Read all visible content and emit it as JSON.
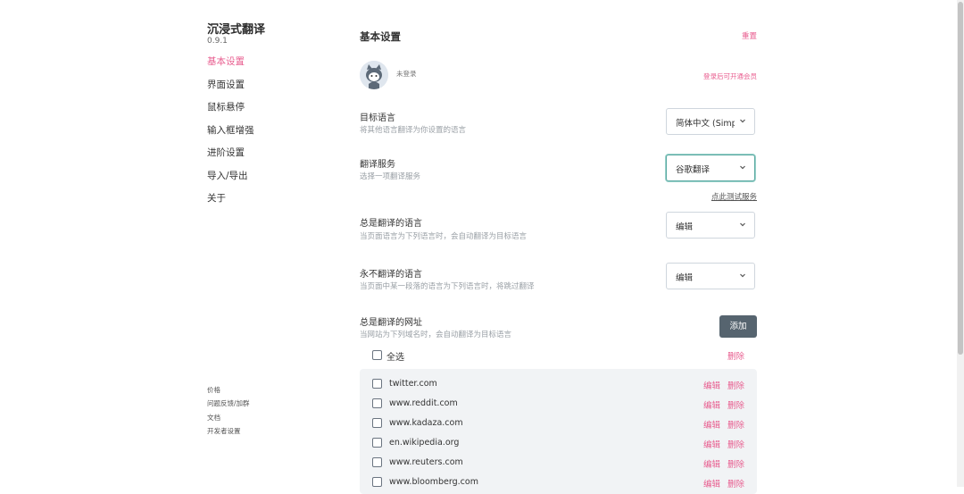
{
  "app": {
    "title": "沉浸式翻译",
    "version": "0.9.1"
  },
  "sidebar": {
    "items": [
      {
        "label": "基本设置",
        "active": true
      },
      {
        "label": "界面设置"
      },
      {
        "label": "鼠标悬停"
      },
      {
        "label": "输入框增强"
      },
      {
        "label": "进阶设置"
      },
      {
        "label": "导入/导出"
      },
      {
        "label": "关于"
      }
    ],
    "footer": [
      "价格",
      "问题反馈/加群",
      "文档",
      "开发者设置"
    ]
  },
  "header": {
    "title": "基本设置",
    "reset_label": "重置"
  },
  "account": {
    "status": "未登录",
    "member_link": "登录后可开通会员"
  },
  "settings": {
    "target_language": {
      "label": "目标语言",
      "desc": "将其他语言翻译为你设置的语言",
      "value": "简体中文 (Simplified Chinese)"
    },
    "service": {
      "label": "翻译服务",
      "desc": "选择一项翻译服务",
      "value": "谷歌翻译",
      "test_link": "点此测试服务"
    },
    "always_translate_langs": {
      "label": "总是翻译的语言",
      "desc": "当页面语言为下列语言时，会自动翻译为目标语言",
      "value": "编辑"
    },
    "never_translate_langs": {
      "label": "永不翻译的语言",
      "desc": "当页面中某一段落的语言为下列语言时，将跳过翻译",
      "value": "编辑"
    },
    "always_translate_urls": {
      "label": "总是翻译的网址",
      "desc": "当网站为下列域名时，会自动翻译为目标语言",
      "add_label": "添加"
    }
  },
  "site_list": {
    "select_all_label": "全选",
    "delete_all_label": "删除",
    "edit_label": "编辑",
    "delete_label": "删除",
    "sites": [
      "twitter.com",
      "www.reddit.com",
      "www.kadaza.com",
      "en.wikipedia.org",
      "www.reuters.com",
      "www.bloomberg.com"
    ]
  },
  "colors": {
    "accent": "#e85d8f",
    "button": "#56646f",
    "focus": "#5aa9a1"
  }
}
